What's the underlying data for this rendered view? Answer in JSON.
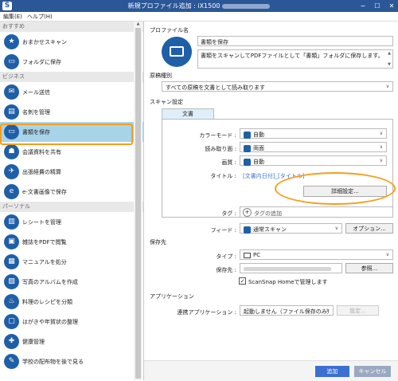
{
  "window": {
    "logo": "S",
    "title": "新規プロファイル追加 : iX1500",
    "minimize": "−",
    "maximize": "☐",
    "close": "✕"
  },
  "menu": {
    "edit": "編集(E)",
    "help": "ヘルプ(H)"
  },
  "sidebar": {
    "sections": [
      {
        "header": "おすすめ",
        "items": [
          {
            "label": "おまかせスキャン",
            "icon": "star-icon",
            "glyph": "★"
          },
          {
            "label": "フォルダに保存",
            "icon": "folder-icon",
            "glyph": "▭"
          }
        ]
      },
      {
        "header": "ビジネス",
        "items": [
          {
            "label": "メール送信",
            "icon": "mail-icon",
            "glyph": "✉"
          },
          {
            "label": "名刺を管理",
            "icon": "business-card-icon",
            "glyph": "▤"
          },
          {
            "label": "書類を保存",
            "icon": "folder-icon",
            "glyph": "▭",
            "selected": true
          },
          {
            "label": "会議資料を共有",
            "icon": "people-icon",
            "glyph": "☗"
          },
          {
            "label": "出張経費の精算",
            "icon": "airplane-icon",
            "glyph": "✈"
          },
          {
            "label": "e-文書画像で保存",
            "icon": "e-document-icon",
            "glyph": "e"
          }
        ]
      },
      {
        "header": "パーソナル",
        "items": [
          {
            "label": "レシートを管理",
            "icon": "receipt-icon",
            "glyph": "▥"
          },
          {
            "label": "雑誌をPDFで閲覧",
            "icon": "magazine-icon",
            "glyph": "▣"
          },
          {
            "label": "マニュアルを処分",
            "icon": "manual-icon",
            "glyph": "▦"
          },
          {
            "label": "写真のアルバムを作成",
            "icon": "photo-album-icon",
            "glyph": "▧"
          },
          {
            "label": "料理のレシピを分類",
            "icon": "recipe-icon",
            "glyph": "♨"
          },
          {
            "label": "はがきや年賀状の整理",
            "icon": "postcard-icon",
            "glyph": "▢"
          },
          {
            "label": "健康管理",
            "icon": "health-icon",
            "glyph": "✚"
          },
          {
            "label": "学校の配布物を後で見る",
            "icon": "school-icon",
            "glyph": "✎"
          }
        ]
      }
    ]
  },
  "profile": {
    "section_label": "プロファイル名",
    "name": "書類を保存",
    "description": "書類をスキャンしてPDFファイルとして「書類」フォルダに保存します。"
  },
  "doc_type": {
    "section_label": "原稿種別",
    "value": "すべての原稿を文書として読み取ります"
  },
  "scan_settings": {
    "section_label": "スキャン設定",
    "tab": "文書",
    "color_mode_label": "カラーモード :",
    "color_mode_value": "自動",
    "side_label": "読み取り面 :",
    "side_value": "両面",
    "quality_label": "画質 :",
    "quality_value": "自動",
    "title_label": "タイトル :",
    "title_value": "[文書内日付]_[タイトル]",
    "detail_button": "詳細設定..."
  },
  "tags": {
    "label": "タグ :",
    "placeholder": "タグの追加"
  },
  "feed": {
    "label": "フィード :",
    "value": "通常スキャン",
    "option_button": "オプション..."
  },
  "save_dest": {
    "section_label": "保存先",
    "type_label": "タイプ :",
    "type_value": "PC",
    "path_label": "保存先 :",
    "browse_button": "参照...",
    "checkbox_label": "ScanSnap Homeで管理します",
    "checked": true
  },
  "application": {
    "section_label": "アプリケーション",
    "linked_label": "連携アプリケーション :",
    "linked_value": "起動しません（ファイル保存のみ）",
    "settings_button": "設定..."
  },
  "footer": {
    "add_button": "追加",
    "cancel_button": "キャンセル"
  },
  "colors": {
    "titlebar": "#2b5797",
    "accent": "#1f5fa8",
    "highlight": "#f59e1b",
    "selected": "#a8d4ea"
  }
}
